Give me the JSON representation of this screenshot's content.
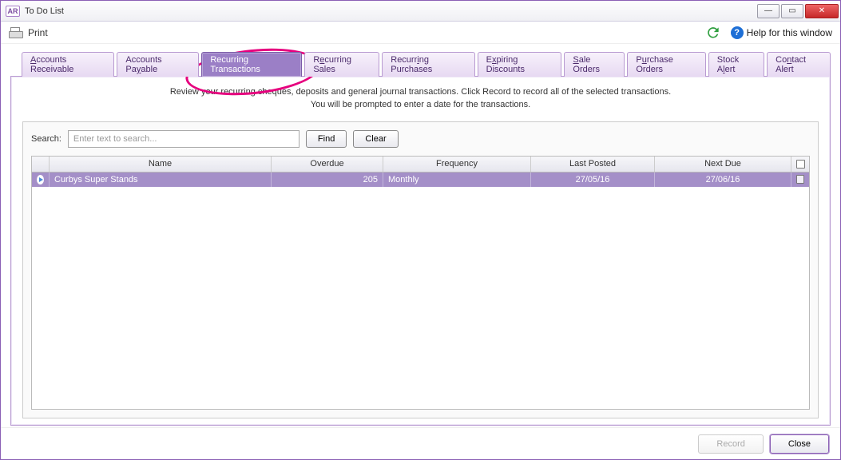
{
  "window": {
    "badge": "AR",
    "title": "To Do List"
  },
  "toolbar": {
    "print": "Print",
    "help": "Help for this window"
  },
  "tabs": [
    {
      "label": "Accounts Receivable",
      "active": false
    },
    {
      "label": "Accounts Payable",
      "active": false
    },
    {
      "label": "Recurring Transactions",
      "active": true
    },
    {
      "label": "Recurring Sales",
      "active": false
    },
    {
      "label": "Recurring Purchases",
      "active": false
    },
    {
      "label": "Expiring Discounts",
      "active": false
    },
    {
      "label": "Sale Orders",
      "active": false
    },
    {
      "label": "Purchase Orders",
      "active": false
    },
    {
      "label": "Stock Alert",
      "active": false
    },
    {
      "label": "Contact Alert",
      "active": false
    }
  ],
  "instructions": {
    "line1": "Review your recurring cheques, deposits and general journal transactions. Click Record to record all of the selected transactions.",
    "line2": "You will be prompted to enter a date for the transactions."
  },
  "search": {
    "label": "Search:",
    "placeholder": "Enter text to search...",
    "find": "Find",
    "clear": "Clear"
  },
  "table": {
    "headers": {
      "name": "Name",
      "overdue": "Overdue",
      "frequency": "Frequency",
      "last": "Last Posted",
      "next": "Next Due"
    },
    "rows": [
      {
        "name": "Curbys Super Stands",
        "overdue": "205",
        "frequency": "Monthly",
        "last": "27/05/16",
        "next": "27/06/16",
        "checked": false
      }
    ]
  },
  "footer": {
    "record": "Record",
    "close": "Close"
  }
}
